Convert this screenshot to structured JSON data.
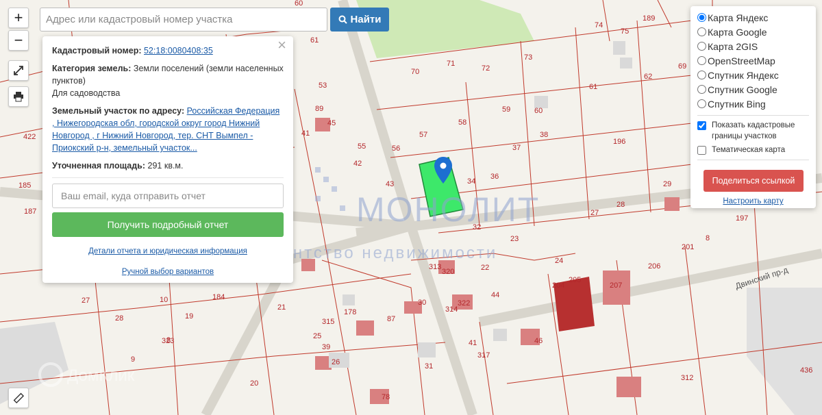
{
  "search": {
    "placeholder": "Адрес или кадастровый номер участка",
    "button_label": "Найти"
  },
  "map_controls": {
    "zoom_in": "+",
    "zoom_out": "−"
  },
  "info_panel": {
    "cadastral_label": "Кадастровый номер:",
    "cadastral_number": "52:18:0080408:35",
    "category_label": "Категория земель:",
    "category_value": "Земли поселений (земли населенных пунктов)",
    "usage": "Для садоводства",
    "address_label": "Земельный участок по адресу:",
    "address_value": "Российская Федерация , Нижегородская обл, городской округ город Нижний Новгород , г Нижний Новгород, тер. СНТ Вымпел - Приокский р-н, земельный участок...",
    "area_label": "Уточненная площадь:",
    "area_value": "291 кв.м.",
    "email_placeholder": "Ваш email, куда отправить отчет",
    "report_button": "Получить подробный отчет",
    "details_link": "Детали отчета и юридическая информация",
    "manual_link": "Ручной выбор вариантов"
  },
  "layers_panel": {
    "options": [
      "Карта Яндекс",
      "Карта Google",
      "Карта 2GIS",
      "OpenStreetMap",
      "Спутник Яндекс",
      "Спутник Google",
      "Спутник Bing"
    ],
    "selected": "Карта Яндекс",
    "show_boundaries_label": "Показать кадастровые границы участков",
    "show_boundaries_checked": true,
    "thematic_label": "Тематическая карта",
    "thematic_checked": false,
    "share_button": "Поделиться ссылкой",
    "setup_link": "Настроить карту"
  },
  "watermark": {
    "brand": "МОНОЛИТ",
    "tagline": "агентство недвижимости",
    "corner_brand": "ДомКлик"
  },
  "map": {
    "street_label": "Двинский пр-д",
    "parcel_labels": [
      "60",
      "61",
      "53",
      "89",
      "41",
      "42",
      "43",
      "55",
      "56",
      "57",
      "58",
      "59",
      "60",
      "61",
      "62",
      "69",
      "70",
      "71",
      "72",
      "73",
      "74",
      "75",
      "189",
      "196",
      "197",
      "206",
      "204",
      "205",
      "207",
      "22",
      "23",
      "24",
      "27",
      "28",
      "29",
      "30",
      "31",
      "32",
      "34",
      "36",
      "37",
      "38",
      "39",
      "313",
      "314",
      "315",
      "317",
      "320",
      "322",
      "323",
      "185",
      "187",
      "184",
      "19",
      "20",
      "21",
      "25",
      "26",
      "27",
      "28",
      "8",
      "9",
      "10",
      "87",
      "78",
      "312",
      "436",
      "422",
      "41",
      "44",
      "46",
      "45",
      "201",
      "178",
      "8",
      "26",
      "199"
    ],
    "colors": {
      "parcel_line": "#c0392b",
      "selected_parcel": "#3de86a",
      "marker": "#1d6fd1",
      "building": "#d66a6a"
    }
  }
}
